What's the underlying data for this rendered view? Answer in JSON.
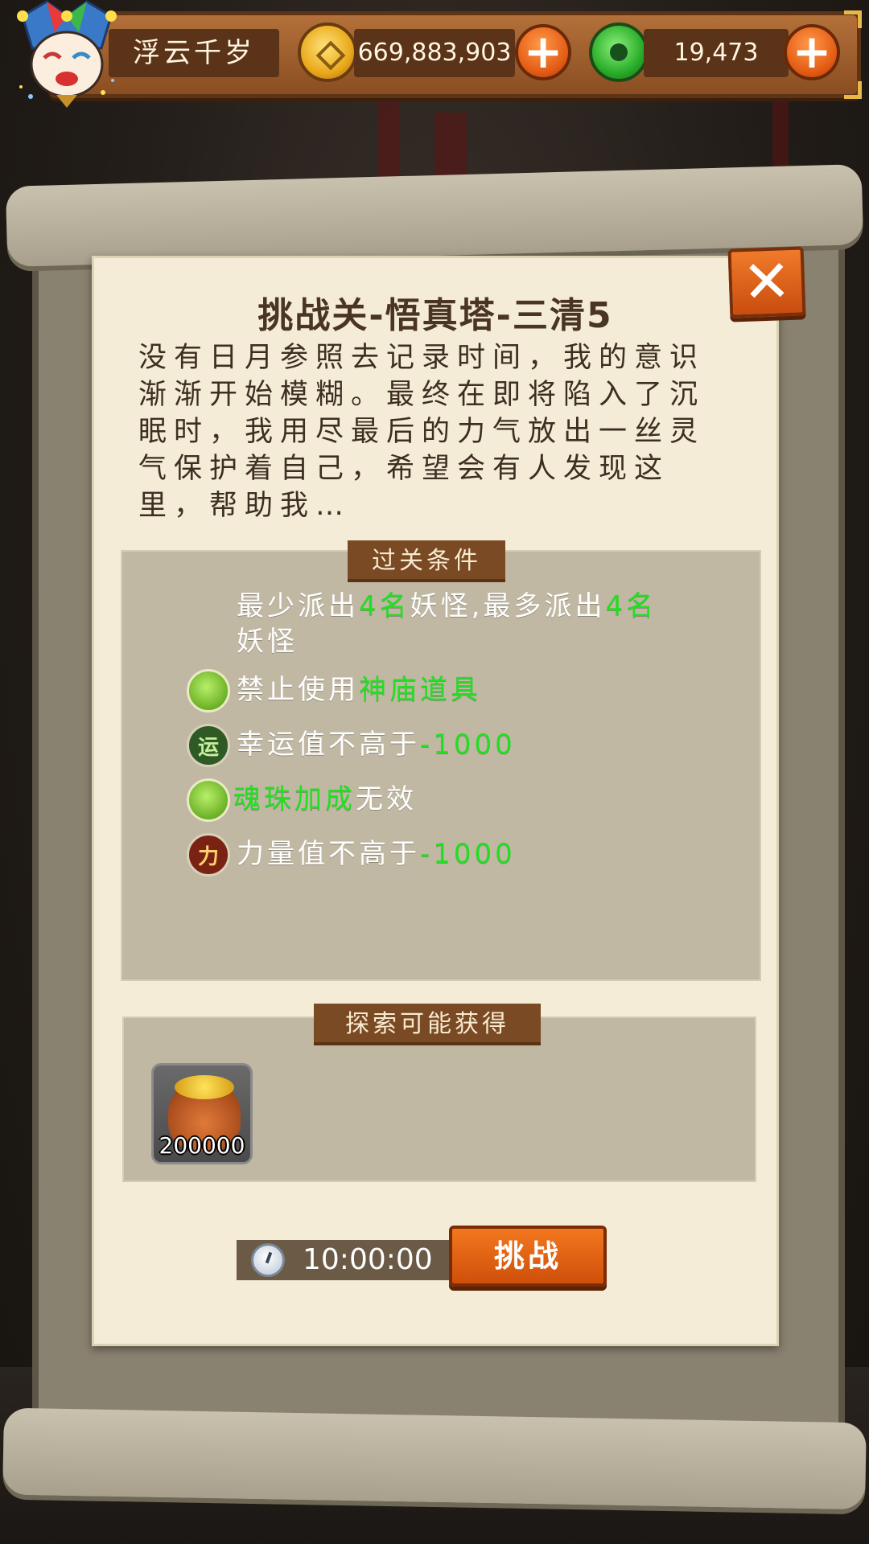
{
  "player": {
    "name": "浮云千岁",
    "avatar_icon": "jester-mask-avatar"
  },
  "currency": {
    "coins": "669,883,903",
    "coin_icon": "gold-coin-icon",
    "jade": "19,473",
    "jade_icon": "green-jade-icon",
    "plus_label": "+"
  },
  "dialog": {
    "close_label": "✕",
    "title": "挑战关-悟真塔-三清5",
    "story": "没有日月参照去记录时间，我的意识渐渐开始模糊。最终在即将陷入了沉眠时，我用尽最后的力气放出一丝灵气保护着自己，希望会有人发现这里，帮助我…",
    "conditions_header": "过关条件",
    "conditions": [
      {
        "parts": [
          "最少派出",
          "4名",
          "妖怪,最多派出",
          "4名",
          "妖怪"
        ]
      },
      {
        "icon": "green-orb-icon",
        "parts": [
          "禁止使用",
          "神庙道具"
        ]
      },
      {
        "icon": "luck-icon",
        "icon_text": "运",
        "parts": [
          "幸运值不高于",
          "-1000"
        ]
      },
      {
        "icon": "green-orb-icon",
        "parts": [
          "魂珠加成",
          "无效"
        ]
      },
      {
        "icon": "power-icon",
        "icon_text": "力",
        "parts": [
          "力量值不高于",
          "-1000"
        ]
      }
    ],
    "rewards_header": "探索可能获得",
    "rewards": [
      {
        "icon": "gold-bag-icon",
        "qty": "200000"
      }
    ],
    "timer": "10:00:00",
    "challenge_label": "挑战"
  },
  "colors": {
    "highlight": "#21e021",
    "button_orange": "#e35b14",
    "paper": "#f4ecd6",
    "section_bg": "#c1b8a4",
    "tag_brown": "#7a4a24"
  }
}
